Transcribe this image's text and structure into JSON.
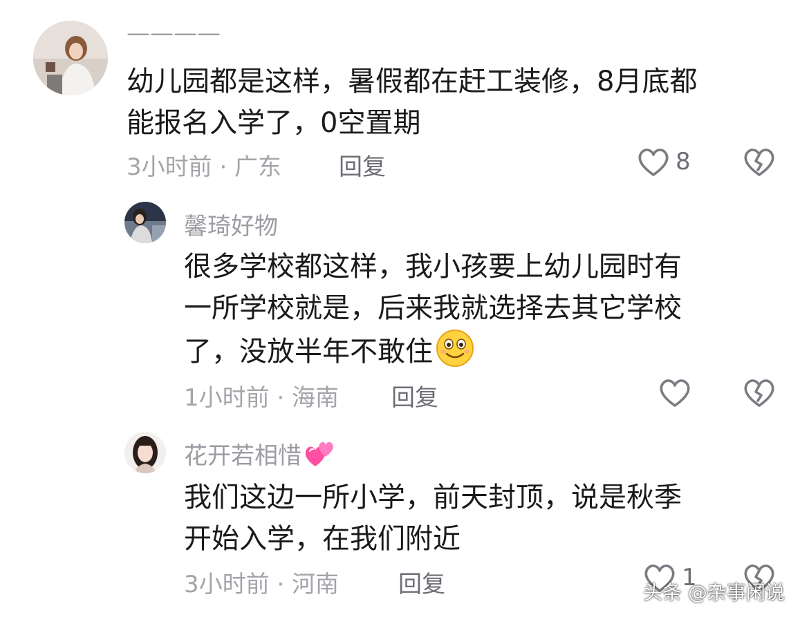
{
  "comments": [
    {
      "username": "————",
      "text_lines": [
        "幼儿园都是这样，暑假都在赶工装修，8月底都",
        "能报名入学了，0空置期"
      ],
      "time_location": "3小时前 · 广东",
      "reply_label": "回复",
      "like_count": "8"
    },
    {
      "username": "馨琦好物",
      "text_lines": [
        "很多学校都这样，我小孩要上幼儿园时有",
        "一所学校就是，后来我就选择去其它学校",
        "了，没放半年不敢住"
      ],
      "time_location": "1小时前 · 海南",
      "reply_label": "回复"
    },
    {
      "username": "花开若相惜",
      "text_lines": [
        "我们这边一所小学，前天封顶，说是秋季",
        "开始入学，在我们附近"
      ],
      "time_location": "3小时前 · 河南",
      "reply_label": "回复",
      "like_count": "1"
    }
  ],
  "watermark": "头条 @杂事闲说",
  "icons": {
    "like": "heart-outline-icon",
    "dislike": "broken-heart-icon",
    "emoji": "smile-emoji-icon",
    "hearts": "two-hearts-icon"
  },
  "colors": {
    "text": "#1a1a1a",
    "name": "#9b9da3",
    "meta": "#a3a5aa",
    "reply": "#6c6e75"
  }
}
